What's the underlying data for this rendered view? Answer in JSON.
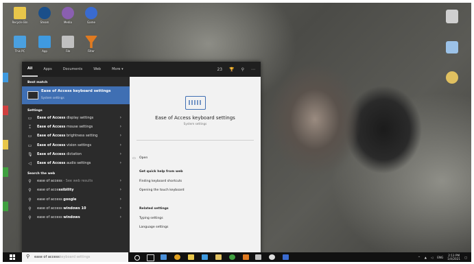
{
  "desktop": {
    "icons": [
      {
        "label": "Recycle Bin",
        "color": "#e8c64a"
      },
      {
        "label": "Steam",
        "color": "#1a4f8a"
      },
      {
        "label": "Media",
        "color": "#8a5fb0"
      },
      {
        "label": "Game",
        "color": "#3a6bd0"
      },
      {
        "label": "This PC",
        "color": "#4aa0e0"
      },
      {
        "label": "App",
        "color": "#3f9ae0"
      },
      {
        "label": "File",
        "color": "#c0c0c0"
      },
      {
        "label": "Filter",
        "color": "#e07a20"
      }
    ]
  },
  "start_menu": {
    "tabs": [
      "All",
      "Apps",
      "Documents",
      "Web",
      "More"
    ],
    "tab_right": [
      "23",
      "⋯"
    ],
    "best_match_header": "Best match",
    "best_match": {
      "title": "Ease of Access keyboard settings",
      "subtitle": "System settings"
    },
    "settings_header": "Settings",
    "settings": [
      {
        "bold": "Ease of Access",
        "rest": " display settings",
        "icon": "▭"
      },
      {
        "bold": "Ease of Access",
        "rest": " mouse settings",
        "icon": "⌶"
      },
      {
        "bold": "Ease of Access",
        "rest": " brightness setting",
        "icon": "▭"
      },
      {
        "bold": "Ease of Access",
        "rest": " vision settings",
        "icon": "▭"
      },
      {
        "bold": "Ease of Access",
        "rest": " dictation",
        "icon": "🎙"
      },
      {
        "bold": "Ease of Access",
        "rest": " audio settings",
        "icon": "◁"
      }
    ],
    "web_header": "Search the web",
    "web": [
      {
        "pre": "ease of access",
        "bold": "",
        "hint": " - See web results"
      },
      {
        "pre": "ease of acce",
        "bold": "ssibility",
        "hint": ""
      },
      {
        "pre": "ease of access ",
        "bold": "google",
        "hint": ""
      },
      {
        "pre": "ease of access ",
        "bold": "windows 10",
        "hint": ""
      },
      {
        "pre": "ease of access ",
        "bold": "windows",
        "hint": ""
      }
    ],
    "preview": {
      "title": "Ease of Access keyboard settings",
      "subtitle": "System settings",
      "open": "Open",
      "quick_help_header": "Get quick help from web",
      "quick_help": [
        "Finding keyboard shortcuts",
        "Opening the touch keyboard"
      ],
      "related_header": "Related settings",
      "related": [
        "Typing settings",
        "Language settings"
      ]
    }
  },
  "taskbar": {
    "search_text": "ease of access",
    "search_hint": "keyboard settings",
    "tray_lang": "ENG",
    "time": "2:13 PM",
    "date": "1/4/2021"
  }
}
